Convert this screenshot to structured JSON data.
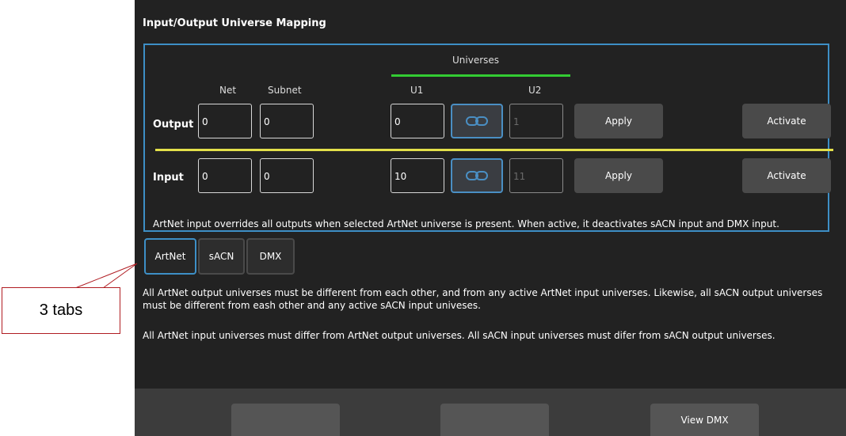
{
  "title": "Input/Output Universe Mapping",
  "universes_label": "Universes",
  "columns": {
    "net": "Net",
    "subnet": "Subnet",
    "u1": "U1",
    "u2": "U2"
  },
  "output": {
    "label": "Output",
    "net": "0",
    "subnet": "0",
    "u1": "0",
    "u2": "1",
    "apply_label": "Apply",
    "activate_label": "Activate"
  },
  "input": {
    "label": "Input",
    "net": "0",
    "subnet": "0",
    "u1": "10",
    "u2": "11",
    "apply_label": "Apply",
    "activate_label": "Activate"
  },
  "note": "ArtNet input overrides all outputs when selected ArtNet universe is present. When active, it deactivates sACN input and DMX input.",
  "tabs": [
    {
      "label": "ArtNet",
      "active": true
    },
    {
      "label": "sACN",
      "active": false
    },
    {
      "label": "DMX",
      "active": false
    }
  ],
  "info_1": "All ArtNet output universes must be different from each other, and from any active ArtNet input universes. Likewise, all sACN output universes must be different from eash other and any active sACN input univeses.",
  "info_2": "All ArtNet input universes must differ from ArtNet output universes. All sACN input universes must difer from sACN output universes.",
  "bottom_buttons": [
    "",
    "",
    "View DMX"
  ],
  "callout": "3 tabs",
  "colors": {
    "panel_bg": "#222222",
    "accent_blue": "#3d8fc6",
    "universe_line": "#33cc33",
    "divider": "#e3e04a",
    "callout_red": "#b01c22"
  },
  "icons": {
    "link": "link-icon"
  }
}
